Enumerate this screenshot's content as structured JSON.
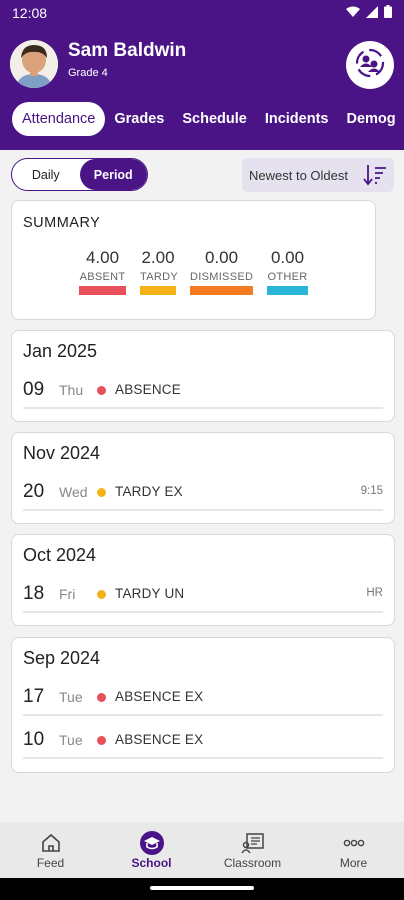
{
  "status": {
    "time": "12:08"
  },
  "student": {
    "name": "Sam Baldwin",
    "grade": "Grade 4"
  },
  "tabs": [
    "Attendance",
    "Grades",
    "Schedule",
    "Incidents",
    "Demog"
  ],
  "toggle": {
    "daily": "Daily",
    "period": "Period",
    "selected": "Period"
  },
  "sort": {
    "label": "Newest to Oldest"
  },
  "summary": {
    "title": "SUMMARY",
    "stats": [
      {
        "value": "4.00",
        "label": "ABSENT",
        "color": "#e8505b"
      },
      {
        "value": "2.00",
        "label": "TARDY",
        "color": "#f5b216"
      },
      {
        "value": "0.00",
        "label": "DISMISSED",
        "color": "#f47b20"
      },
      {
        "value": "0.00",
        "label": "OTHER",
        "color": "#29b6d8"
      }
    ]
  },
  "months": [
    {
      "title": "Jan 2025",
      "entries": [
        {
          "day": "09",
          "dow": "Thu",
          "type": "ABSENCE",
          "period": "",
          "color": "#e8505b"
        }
      ]
    },
    {
      "title": "Nov 2024",
      "entries": [
        {
          "day": "20",
          "dow": "Wed",
          "type": "TARDY EX",
          "period": "9:15",
          "color": "#f5b216"
        }
      ]
    },
    {
      "title": "Oct 2024",
      "entries": [
        {
          "day": "18",
          "dow": "Fri",
          "type": "TARDY UN",
          "period": "HR",
          "color": "#f5b216"
        }
      ]
    },
    {
      "title": "Sep 2024",
      "entries": [
        {
          "day": "17",
          "dow": "Tue",
          "type": "ABSENCE EX",
          "period": "",
          "color": "#e8505b"
        },
        {
          "day": "10",
          "dow": "Tue",
          "type": "ABSENCE EX",
          "period": "",
          "color": "#e8505b"
        }
      ]
    }
  ],
  "nav": [
    {
      "label": "Feed",
      "icon": "home-icon"
    },
    {
      "label": "School",
      "icon": "school-icon"
    },
    {
      "label": "Classroom",
      "icon": "classroom-icon"
    },
    {
      "label": "More",
      "icon": "more-icon"
    }
  ],
  "colors": {
    "brand": "#4a1486",
    "absent": "#e8505b",
    "tardy": "#f5b216",
    "dismissed": "#f47b20",
    "other": "#29b6d8"
  }
}
